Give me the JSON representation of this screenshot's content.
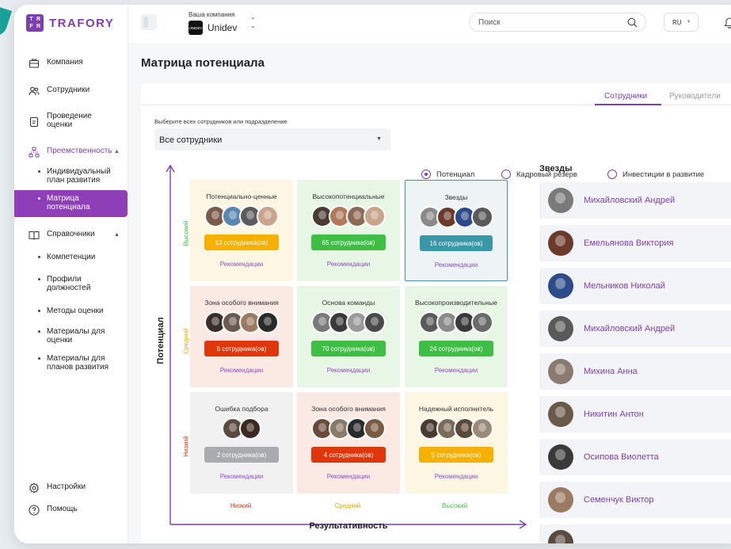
{
  "brand": {
    "logo_letters": "TRFR",
    "name": "TRAFORY"
  },
  "sidebar": {
    "items": [
      {
        "label": "Компания",
        "icon": "building-icon"
      },
      {
        "label": "Сотрудники",
        "icon": "users-icon"
      },
      {
        "label": "Проведение оценки",
        "icon": "clipboard-icon"
      },
      {
        "label": "Преемственность",
        "icon": "org-chart-icon"
      },
      {
        "label": "Справочники",
        "icon": "book-icon"
      }
    ],
    "succession_sub": [
      "Индивидуальный план развития",
      "Матрица потенциала"
    ],
    "reference_sub": [
      "Компетенции",
      "Профили должностей",
      "Методы оценки",
      "Материалы для оценки",
      "Материалы для планов развития"
    ],
    "settings": "Настройки",
    "help": "Помощь"
  },
  "header": {
    "company_caption": "Ваша компания",
    "company_name": "Unidev",
    "company_logo_text": "UNIDEV",
    "search_placeholder": "Поиск",
    "language": "RU"
  },
  "page": {
    "title": "Матрица потенциала",
    "tabs": [
      "Сотрудники",
      "Руководители"
    ],
    "filter_caption": "Выберите всех сотрудников или подразделение",
    "filter_value": "Все сотрудники",
    "radios": [
      "Потенциал",
      "Кадровый резерв",
      "Инвестиции в развитие"
    ],
    "selected_radio": "Потенциал"
  },
  "matrix": {
    "y_label": "Потенциал",
    "x_label": "Результативность",
    "y_levels": [
      "Высокий",
      "Средний",
      "Низкий"
    ],
    "x_levels": [
      "Низкий",
      "Средний",
      "Высокий"
    ],
    "recommend": "Рекомендации",
    "cells": [
      {
        "title": "Потенциально-ценные",
        "count": "13 сотрудника(ов)"
      },
      {
        "title": "Высокопотенциальные",
        "count": "65 сотрудника(ов)"
      },
      {
        "title": "Звезды",
        "count": "16 сотрудника(ов)"
      },
      {
        "title": "Зона особого внимания",
        "count": "5 сотрудника(ов)"
      },
      {
        "title": "Основа команды",
        "count": "70 сотрудника(ов)"
      },
      {
        "title": "Высокопроизводительные",
        "count": "24 сотрудника(ов)"
      },
      {
        "title": "Ошибка подбора",
        "count": "2 сотрудника(ов)"
      },
      {
        "title": "Зона особого внимания",
        "count": "4 сотрудника(ов)"
      },
      {
        "title": "Надежный исполнитель",
        "count": "5 сотрудника(ов)"
      }
    ]
  },
  "stars": {
    "heading": "Звезды",
    "people": [
      "Михайловский Андрей",
      "Емельянова Виктория",
      "Мельников Николай",
      "Михайловский Андрей",
      "Михина Анна",
      "Никитин Антон",
      "Осипова Виолетта",
      "Семенчук Виктор"
    ]
  },
  "colors": {
    "accent": "#7d3fb0",
    "high_bg": "#fdf6e3",
    "green_bg": "#e8f6e5",
    "star_bg": "#eef4f6",
    "red_bg": "#fbe9e4",
    "grey_bg": "#f1f1f1",
    "orange": "#f5b000",
    "green": "#3fbe45",
    "teal": "#3a97a8",
    "red": "#e0360c",
    "grey": "#a9abae"
  }
}
